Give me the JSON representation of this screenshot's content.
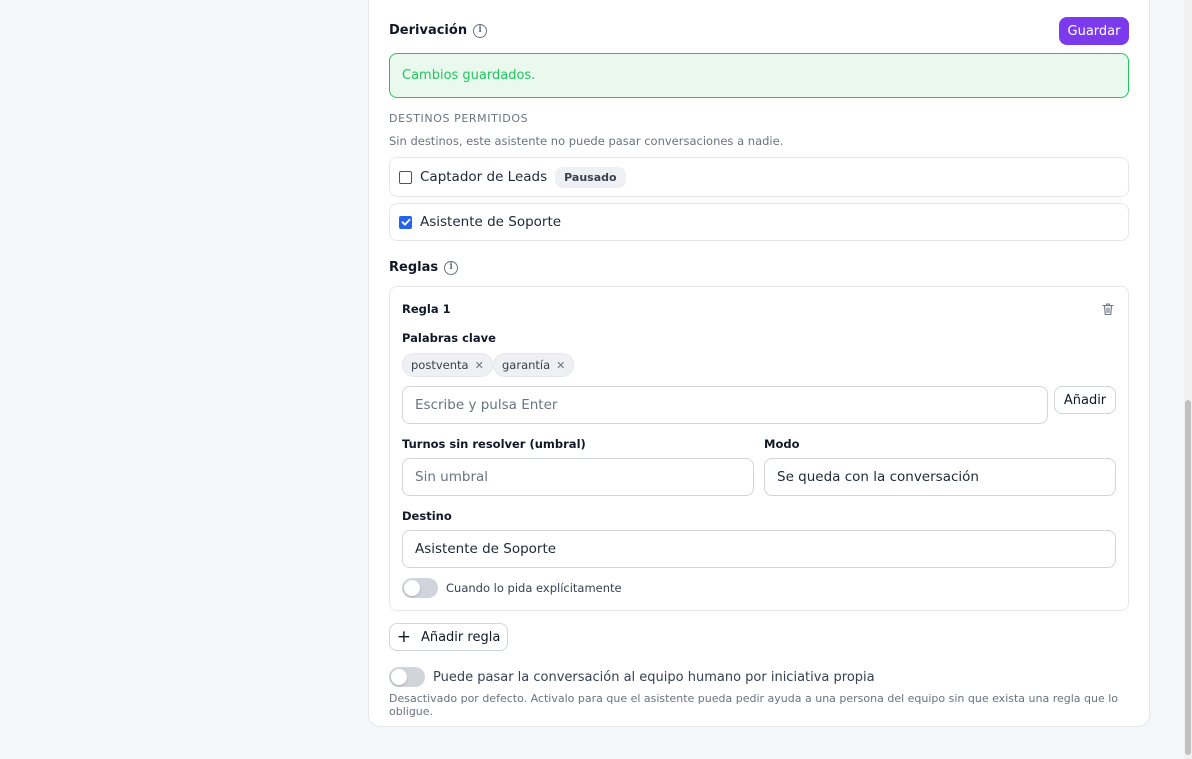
{
  "derivacion": {
    "title": "Derivación",
    "save_label": "Guardar",
    "success_message": "Cambios guardados.",
    "destinations_heading": "DESTINOS PERMITIDOS",
    "destinations_hint": "Sin destinos, este asistente no puede pasar conversaciones a nadie.",
    "destinations": [
      {
        "label": "Captador de Leads",
        "checked": false,
        "badge": "Pausado"
      },
      {
        "label": "Asistente de Soporte",
        "checked": true,
        "badge": ""
      }
    ]
  },
  "reglas": {
    "title": "Reglas",
    "rules": [
      {
        "title": "Regla 1",
        "keywords_label": "Palabras clave",
        "keywords": [
          "postventa",
          "garantía"
        ],
        "keyword_input_placeholder": "Escribe y pulsa Enter",
        "add_keyword_label": "Añadir",
        "threshold_label": "Turnos sin resolver (umbral)",
        "threshold_placeholder": "Sin umbral",
        "mode_label": "Modo",
        "mode_value": "Se queda con la conversación",
        "destination_label": "Destino",
        "destination_value": "Asistente de Soporte",
        "explicit_toggle_label": "Cuando lo pida explícitamente",
        "explicit_toggle_on": false
      }
    ],
    "add_rule_label": "Añadir regla"
  },
  "human_handoff": {
    "toggle_label": "Puede pasar la conversación al equipo humano por iniciativa propia",
    "toggle_on": false,
    "hint": "Desactivado por defecto. Activalo para que el asistente pueda pedir ayuda a una persona del equipo sin que exista una regla que lo obligue."
  },
  "colors": {
    "accent": "#7c3aed",
    "success": "#22c55e",
    "checkbox": "#2563eb"
  }
}
